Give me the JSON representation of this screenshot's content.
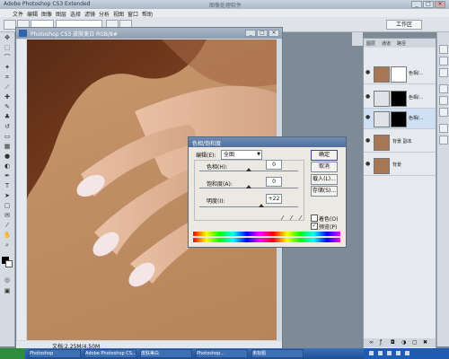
{
  "app": {
    "title": "Adobe Photoshop CS3 Extended",
    "caption": "图像处理软件"
  },
  "menubar": {
    "items": [
      "文件",
      "编辑",
      "图像",
      "图层",
      "选择",
      "滤镜",
      "分析",
      "视图",
      "窗口",
      "帮助"
    ]
  },
  "optionsbar": {
    "workspace_label": "工作区"
  },
  "document": {
    "title": "Photoshop CS3 皮肤美白 RGB/8#",
    "status": "文档:2.25M/4.50M"
  },
  "layers_panel": {
    "tabs": [
      "图层",
      "通道",
      "路径"
    ],
    "layers": [
      {
        "name": "色相/...",
        "visible": true
      },
      {
        "name": "色相/...",
        "visible": true
      },
      {
        "name": "色相/...",
        "visible": true
      },
      {
        "name": "背景 副本",
        "visible": true
      },
      {
        "name": "背景",
        "visible": true
      }
    ]
  },
  "dialog": {
    "title": "色相/饱和度",
    "edit_label": "编辑(E):",
    "edit_value": "全图",
    "hue_label": "色相(H):",
    "hue_value": "0",
    "saturation_label": "饱和度(A):",
    "saturation_value": "0",
    "lightness_label": "明度(I):",
    "lightness_value": "+22",
    "ok_label": "确定",
    "cancel_label": "取消",
    "load_label": "载入(L)...",
    "save_label": "存储(S)...",
    "colorize_label": "着色(O)",
    "preview_label": "预览(P)",
    "colorize_checked": false,
    "preview_checked": true
  },
  "taskbar": {
    "tasks": [
      "Photoshop",
      "Adobe Photoshop CS...",
      "皮肤美白",
      "Photoshop...",
      "未标题"
    ]
  }
}
